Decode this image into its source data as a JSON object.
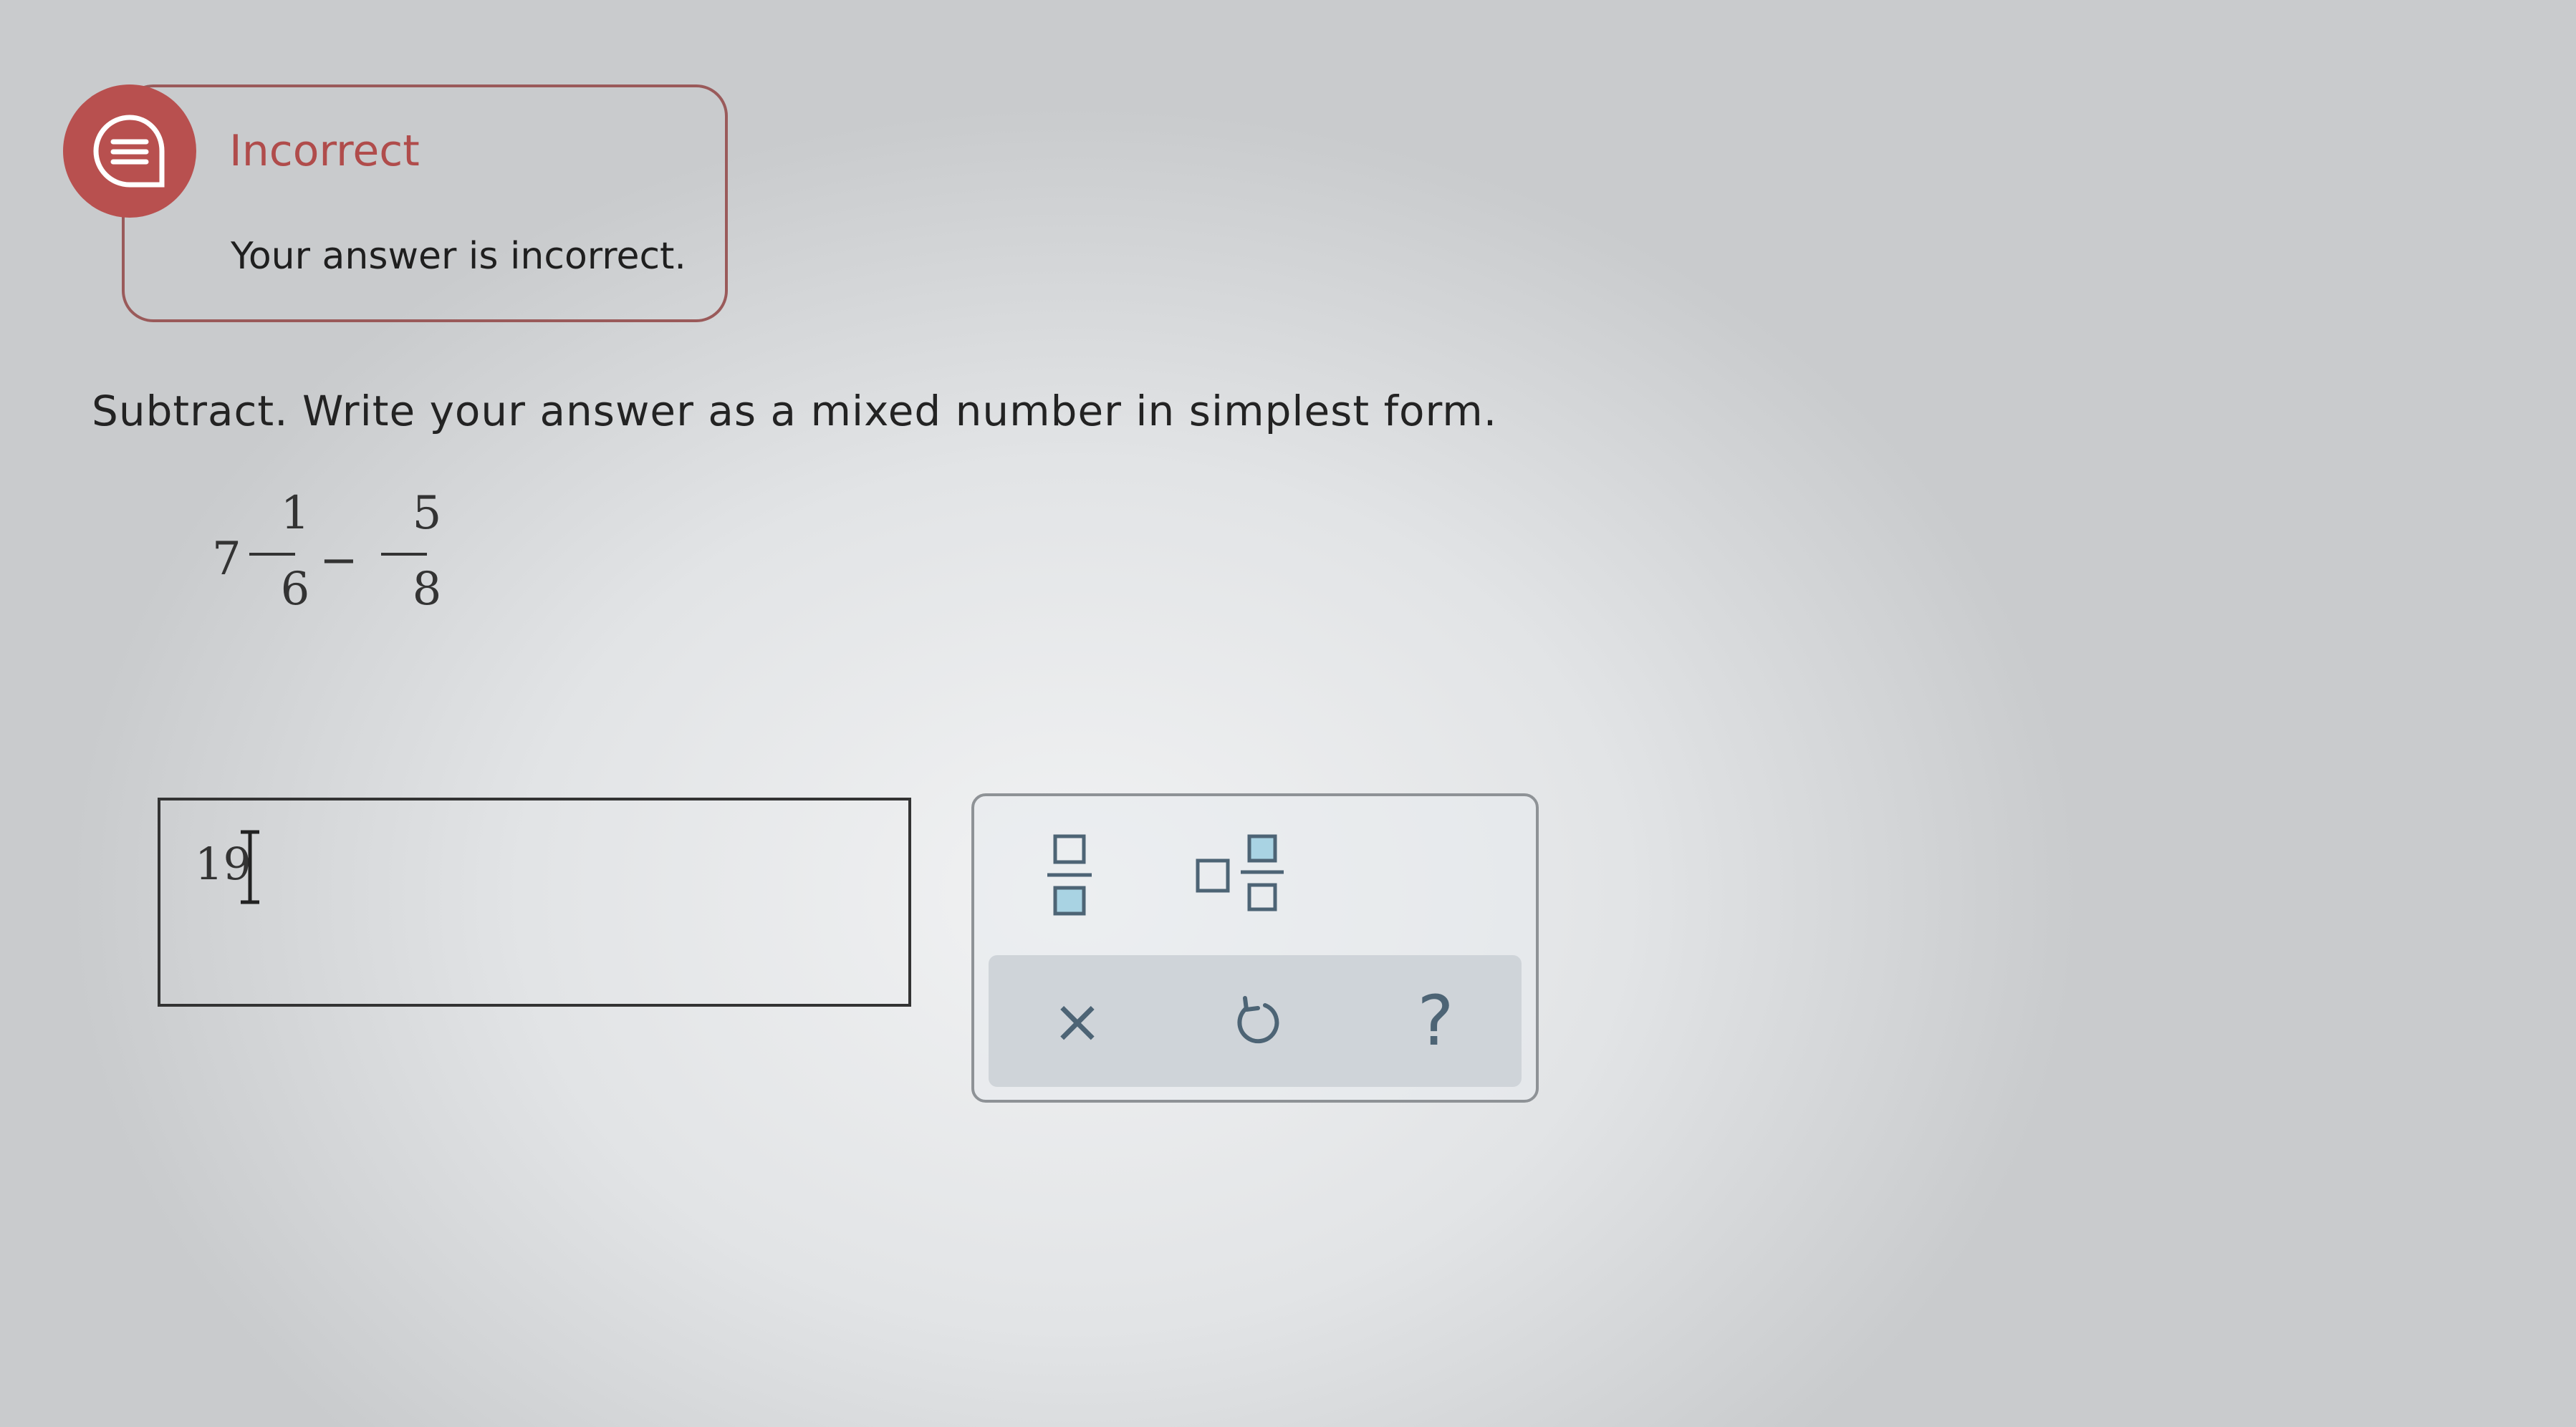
{
  "feedback": {
    "title": "Incorrect",
    "message": "Your answer is incorrect.",
    "icon": "chat-bubble-icon",
    "accent_color": "#b8504f"
  },
  "question": {
    "instruction": "Subtract. Write your answer as a mixed number in simplest form.",
    "expression": {
      "whole": "7",
      "first_numerator": "1",
      "first_denominator": "6",
      "operator": "−",
      "second_numerator": "5",
      "second_denominator": "8"
    }
  },
  "answer": {
    "value": "19"
  },
  "keypad": {
    "templates": [
      "fraction-icon",
      "mixed-number-icon"
    ],
    "actions": {
      "clear_label": "×",
      "undo_icon": "undo-icon",
      "help_label": "?"
    }
  }
}
